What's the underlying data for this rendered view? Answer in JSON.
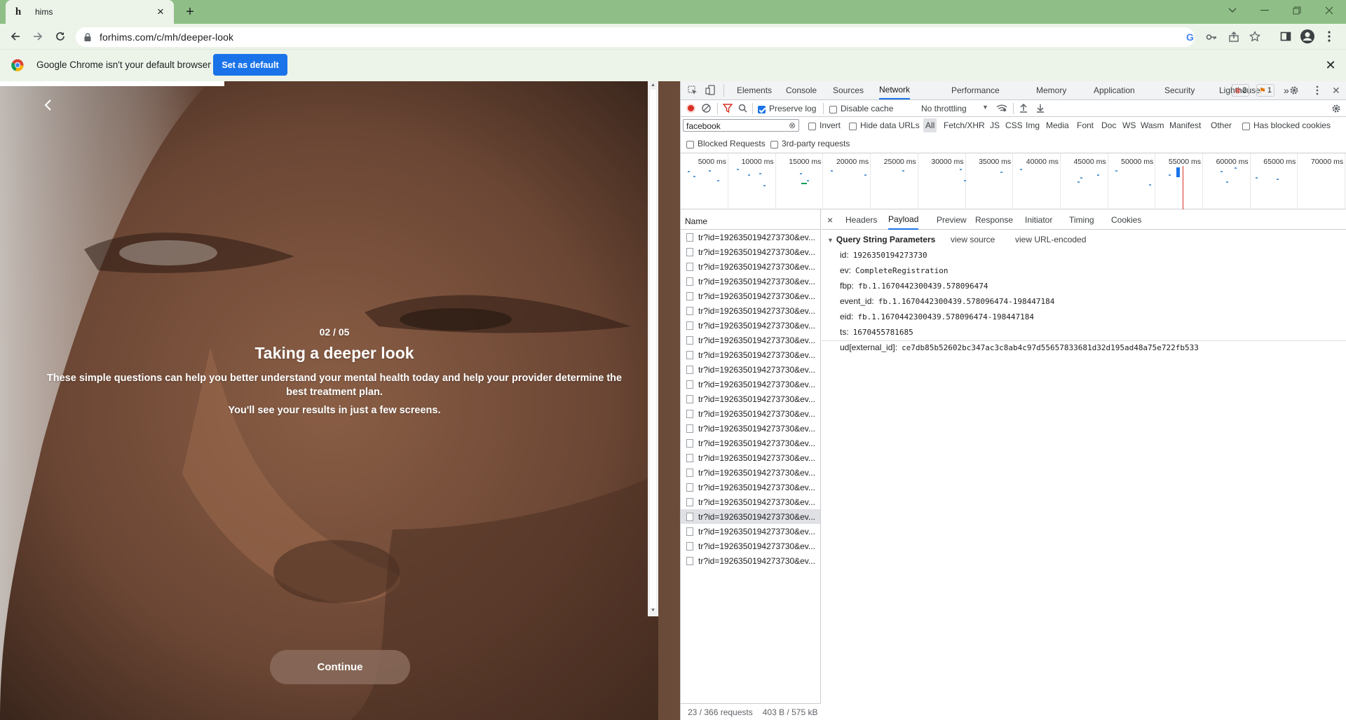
{
  "browser": {
    "tab_title": "hims",
    "tab_favicon": "h",
    "url": "forhims.com/c/mh/deeper-look",
    "infobar_text": "Google Chrome isn't your default browser",
    "set_default_label": "Set as default"
  },
  "page": {
    "step": "02 / 05",
    "title": "Taking a deeper look",
    "description": "These simple questions can help you better understand your mental health today and help your provider determine the best treatment plan.",
    "subtext": "You'll see your results in just a few screens.",
    "continue_label": "Continue"
  },
  "devtools": {
    "tabs": [
      "Elements",
      "Console",
      "Sources",
      "Network",
      "Performance",
      "Memory",
      "Application",
      "Security",
      "Lighthouse"
    ],
    "active_tab": "Network",
    "errors_count": "2",
    "warnings_count": "1",
    "preserve_log": "Preserve log",
    "disable_cache": "Disable cache",
    "throttling": "No throttling",
    "filter_value": "facebook",
    "invert": "Invert",
    "hide_data_urls": "Hide data URLs",
    "filter_types": [
      "All",
      "Fetch/XHR",
      "JS",
      "CSS",
      "Img",
      "Media",
      "Font",
      "Doc",
      "WS",
      "Wasm",
      "Manifest",
      "Other"
    ],
    "has_blocked_cookies": "Has blocked cookies",
    "blocked_requests": "Blocked Requests",
    "third_party": "3rd-party requests",
    "timeline_ticks": [
      "5000 ms",
      "10000 ms",
      "15000 ms",
      "20000 ms",
      "25000 ms",
      "30000 ms",
      "35000 ms",
      "40000 ms",
      "45000 ms",
      "50000 ms",
      "55000 ms",
      "60000 ms",
      "65000 ms",
      "70000 ms"
    ],
    "name_header": "Name",
    "request_name": "tr?id=1926350194273730&ev...",
    "request_rows": [
      "tr?id=1926350194273730&ev...",
      "tr?id=1926350194273730&ev...",
      "tr?id=1926350194273730&ev...",
      "tr?id=1926350194273730&ev...",
      "tr?id=1926350194273730&ev...",
      "tr?id=1926350194273730&ev...",
      "tr?id=1926350194273730&ev...",
      "tr?id=1926350194273730&ev...",
      "tr?id=1926350194273730&ev...",
      "tr?id=1926350194273730&ev...",
      "tr?id=1926350194273730&ev...",
      "tr?id=1926350194273730&ev...",
      "tr?id=1926350194273730&ev...",
      "tr?id=1926350194273730&ev...",
      "tr?id=1926350194273730&ev...",
      "tr?id=1926350194273730&ev...",
      "tr?id=1926350194273730&ev...",
      "tr?id=1926350194273730&ev...",
      "tr?id=1926350194273730&ev...",
      "tr?id=1926350194273730&ev...",
      "tr?id=1926350194273730&ev...",
      "tr?id=1926350194273730&ev...",
      "tr?id=1926350194273730&ev..."
    ],
    "selected_row": 19,
    "status_requests": "23 / 366 requests",
    "status_size": "403 B / 575 kB",
    "detail_tabs": [
      "Headers",
      "Payload",
      "Preview",
      "Response",
      "Initiator",
      "Timing",
      "Cookies"
    ],
    "active_detail_tab": "Payload",
    "section_title": "Query String Parameters",
    "view_source": "view source",
    "view_url_encoded": "view URL-encoded",
    "params": [
      {
        "key": "id:",
        "value": "1926350194273730"
      },
      {
        "key": "ev:",
        "value": "CompleteRegistration"
      },
      {
        "key": "fbp:",
        "value": "fb.1.1670442300439.578096474"
      },
      {
        "key": "event_id:",
        "value": "fb.1.1670442300439.578096474-198447184"
      },
      {
        "key": "eid:",
        "value": "fb.1.1670442300439.578096474-198447184"
      },
      {
        "key": "ts:",
        "value": "1670455781685"
      },
      {
        "key": "ud[external_id]:",
        "value": "ce7db85b52602bc347ac3c8ab4c97d55657833681d32d195ad48a75e722fb533"
      }
    ]
  },
  "colors": {
    "accent": "#1a73e8",
    "tabstrip": "#8fbf87",
    "chrome_bg": "#ecf4e9"
  }
}
